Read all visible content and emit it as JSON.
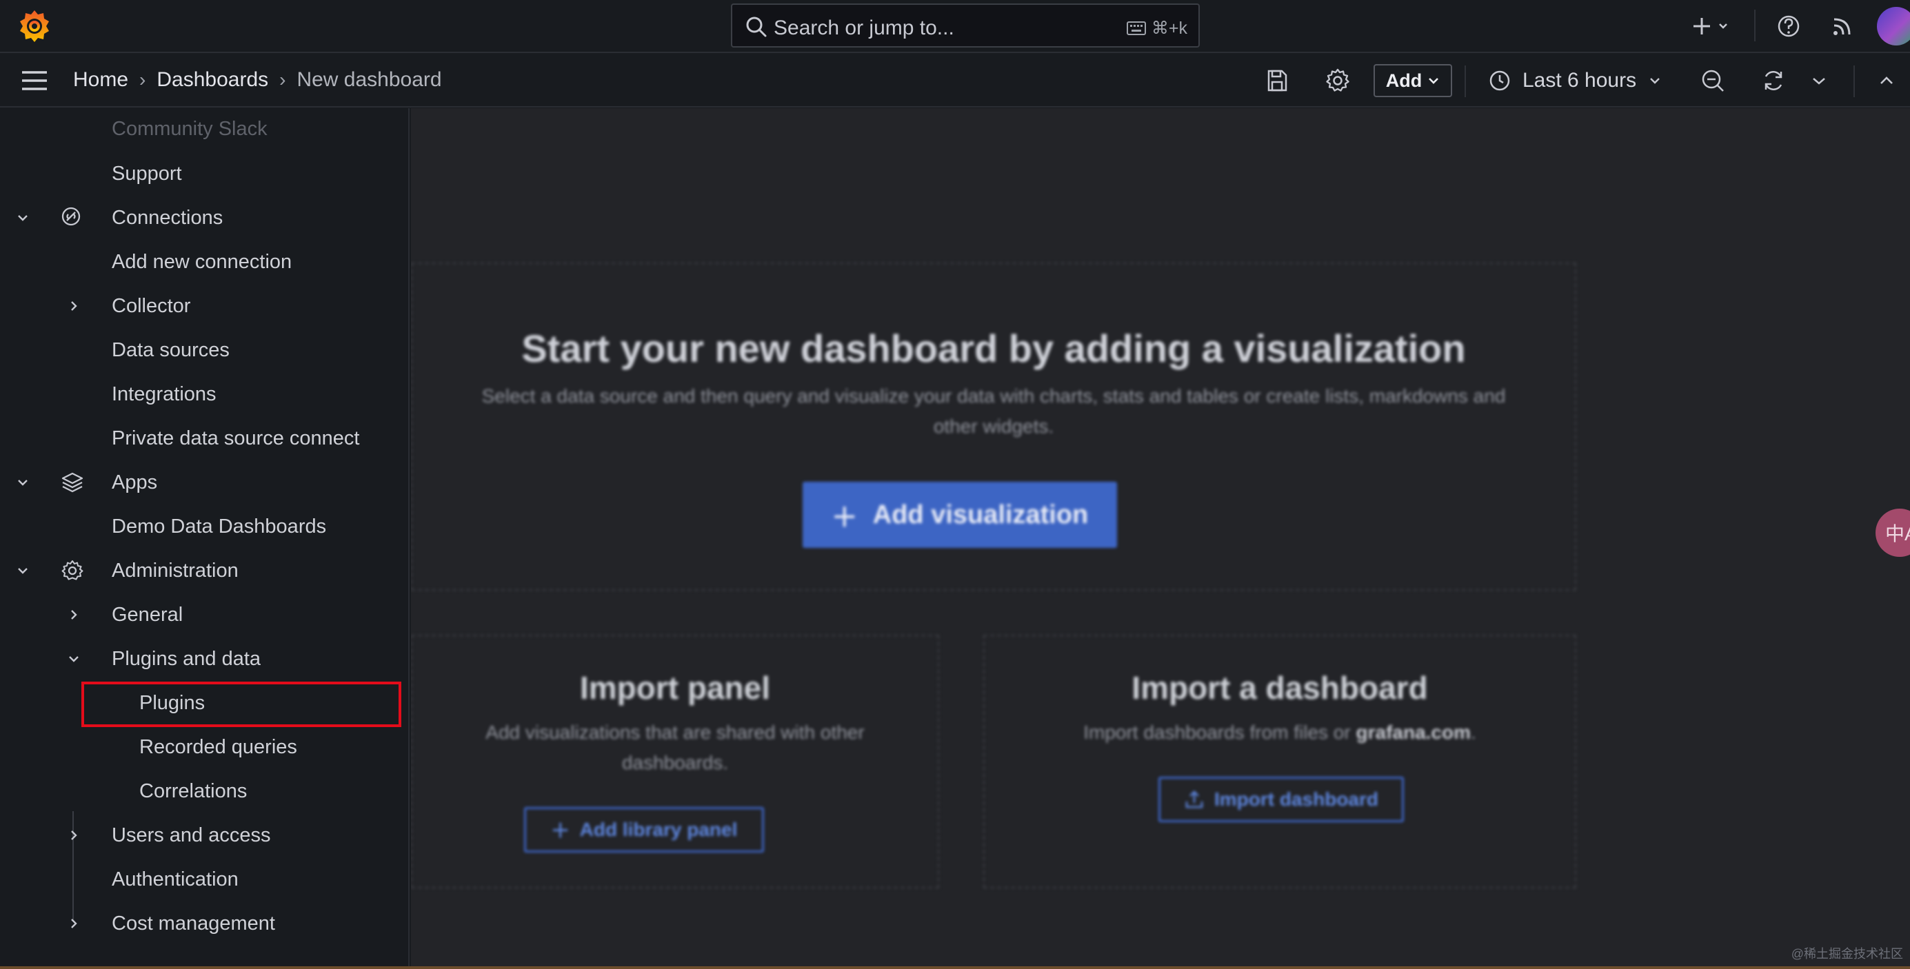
{
  "topbar": {
    "search_placeholder": "Search or jump to...",
    "search_shortcut": "⌘+k"
  },
  "breadcrumb": {
    "items": [
      "Home",
      "Dashboards",
      "New dashboard"
    ],
    "separator": "›"
  },
  "toolbar": {
    "add_label": "Add",
    "time_range": "Last 6 hours"
  },
  "sidebar": {
    "items": [
      {
        "label": "Community Slack",
        "level": 1,
        "chevron": "none"
      },
      {
        "label": "Support",
        "level": 1,
        "chevron": "none"
      },
      {
        "label": "Connections",
        "level": 0,
        "chevron": "down",
        "icon": "connections-icon"
      },
      {
        "label": "Add new connection",
        "level": 1,
        "chevron": "none"
      },
      {
        "label": "Collector",
        "level": 1,
        "chevron": "right"
      },
      {
        "label": "Data sources",
        "level": 1,
        "chevron": "none"
      },
      {
        "label": "Integrations",
        "level": 1,
        "chevron": "none"
      },
      {
        "label": "Private data source connect",
        "level": 1,
        "chevron": "none"
      },
      {
        "label": "Apps",
        "level": 0,
        "chevron": "down",
        "icon": "layers-icon"
      },
      {
        "label": "Demo Data Dashboards",
        "level": 1,
        "chevron": "none"
      },
      {
        "label": "Administration",
        "level": 0,
        "chevron": "down",
        "icon": "gear-icon"
      },
      {
        "label": "General",
        "level": 1,
        "chevron": "right"
      },
      {
        "label": "Plugins and data",
        "level": 1,
        "chevron": "down"
      },
      {
        "label": "Plugins",
        "level": 2,
        "chevron": "none",
        "highlighted": true
      },
      {
        "label": "Recorded queries",
        "level": 2,
        "chevron": "none"
      },
      {
        "label": "Correlations",
        "level": 2,
        "chevron": "none"
      },
      {
        "label": "Users and access",
        "level": 1,
        "chevron": "right"
      },
      {
        "label": "Authentication",
        "level": 1,
        "chevron": "none"
      },
      {
        "label": "Cost management",
        "level": 1,
        "chevron": "right"
      }
    ]
  },
  "main": {
    "hero": {
      "title": "Start your new dashboard by adding a visualization",
      "subtitle": "Select a data source and then query and visualize your data with charts, stats and tables or create lists, markdowns and other widgets.",
      "button": "Add visualization"
    },
    "import_panel": {
      "title": "Import panel",
      "subtitle": "Add visualizations that are shared with other dashboards.",
      "button": "Add library panel"
    },
    "import_dashboard": {
      "title": "Import a dashboard",
      "subtitle_prefix": "Import dashboards from files or ",
      "subtitle_link": "grafana.com",
      "subtitle_suffix": ".",
      "button": "Import dashboard"
    }
  },
  "float_button": "中A",
  "watermark": "@稀土掘金技术社区",
  "colors": {
    "accent": "#3d65c4",
    "highlight_box": "#e30c1a",
    "grafana_orange": "#f46800"
  }
}
